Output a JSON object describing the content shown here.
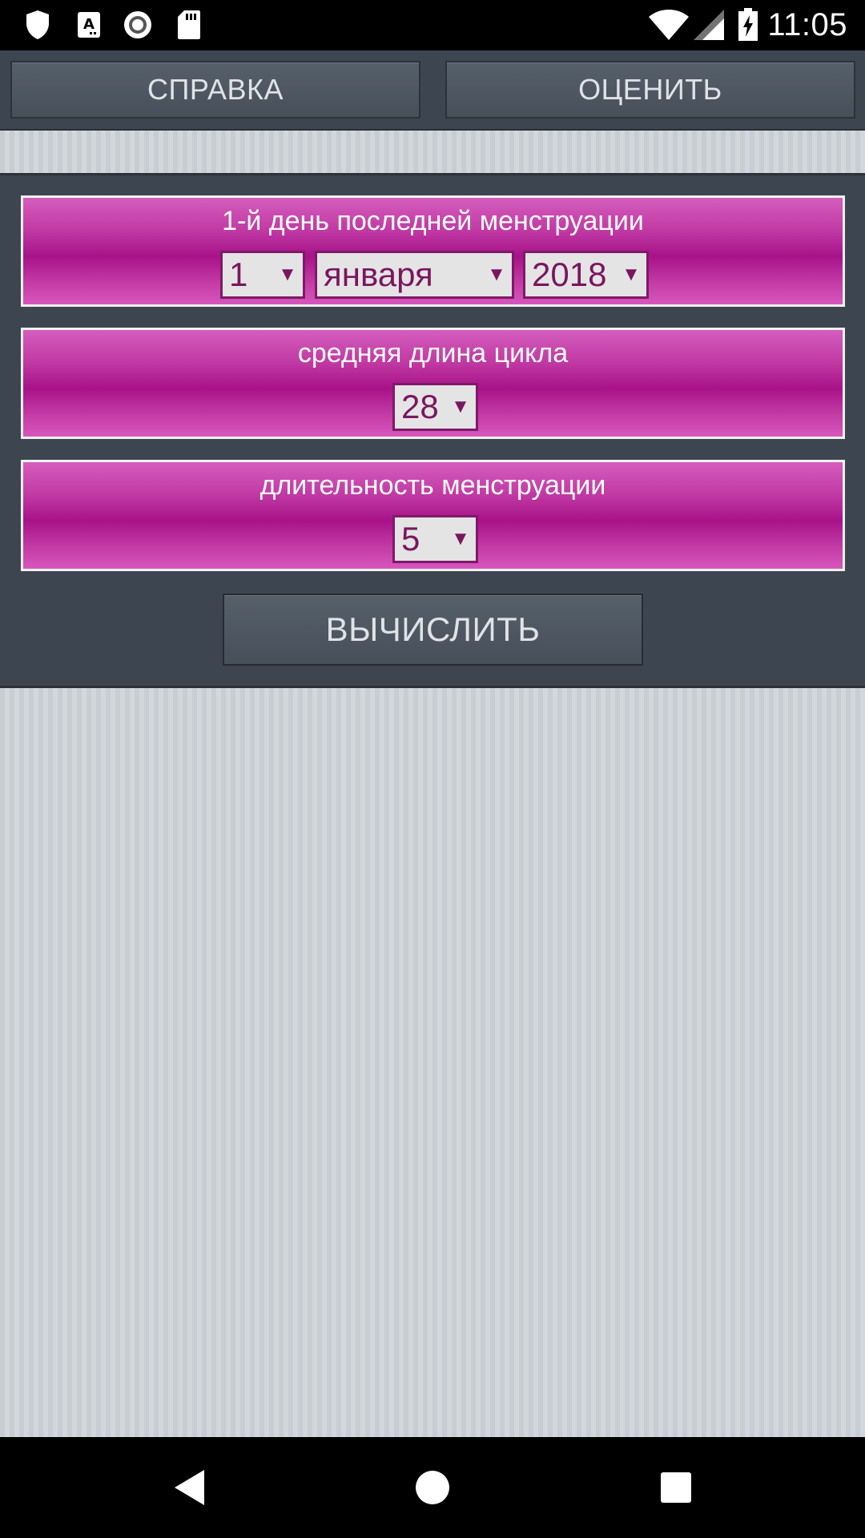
{
  "status_bar": {
    "time": "11:05",
    "icons": [
      "shield-icon",
      "accessibility-a-icon",
      "record-icon",
      "sd-card-icon",
      "wifi-icon",
      "cell-signal-icon",
      "battery-charging-icon"
    ]
  },
  "toolbar": {
    "help_label": "СПРАВКА",
    "rate_label": "ОЦЕНИТЬ"
  },
  "form": {
    "last_period": {
      "label": "1-й день последней менструации",
      "day": "1",
      "month": "января",
      "year": "2018"
    },
    "cycle_length": {
      "label": "средняя длина цикла",
      "value": "28"
    },
    "period_length": {
      "label": "длительность менструации",
      "value": "5"
    },
    "calculate_label": "ВЫЧИСЛИТЬ",
    "dropdown_arrow": "▼"
  },
  "colors": {
    "field_gradient_mid": "#a8128a",
    "panel_bg": "#3d4650",
    "select_text": "#7a165f",
    "stripe_bg": "#c9cfd5"
  }
}
